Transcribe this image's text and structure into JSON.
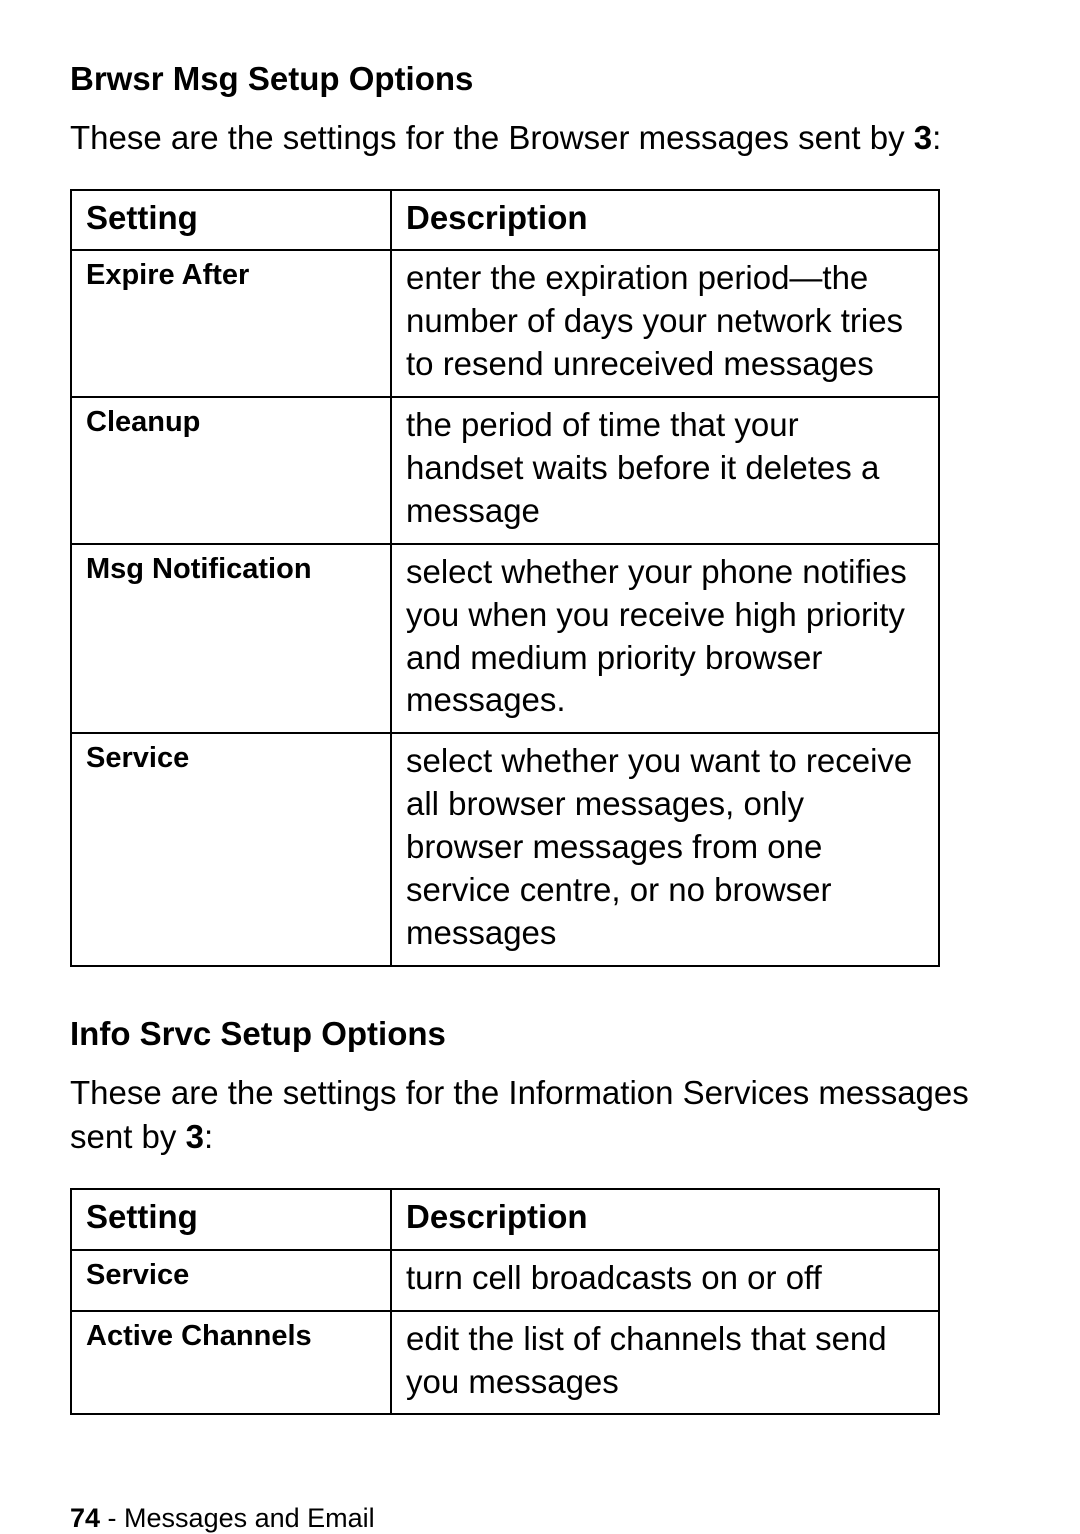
{
  "section1": {
    "heading": "Brwsr Msg Setup Options",
    "intro_prefix": "These are the settings for the Browser messages sent by ",
    "intro_brand": "3",
    "intro_suffix": ":",
    "table": {
      "headers": {
        "setting": "Setting",
        "description": "Description"
      },
      "rows": [
        {
          "setting": "Expire After",
          "description": "enter the expiration period—the number of days your network tries to resend unreceived messages"
        },
        {
          "setting": "Cleanup",
          "description": "the period of time that your handset waits before it deletes a message"
        },
        {
          "setting": "Msg Notification",
          "description": "select whether your phone notifies you when you receive high priority and medium priority browser messages."
        },
        {
          "setting": "Service",
          "description": "select whether you want to receive all browser messages, only browser messages from one service centre, or no browser messages"
        }
      ]
    }
  },
  "section2": {
    "heading": "Info Srvc Setup Options",
    "intro_prefix": "These are the settings for the Information Services messages sent by ",
    "intro_brand": "3",
    "intro_suffix": ":",
    "table": {
      "headers": {
        "setting": "Setting",
        "description": "Description"
      },
      "rows": [
        {
          "setting": "Service",
          "description": "turn cell broadcasts on or off"
        },
        {
          "setting": "Active Channels",
          "description": "edit the list of channels that send you messages"
        }
      ]
    }
  },
  "footer": {
    "page_number": "74",
    "separator": " - ",
    "chapter": "Messages and Email"
  }
}
